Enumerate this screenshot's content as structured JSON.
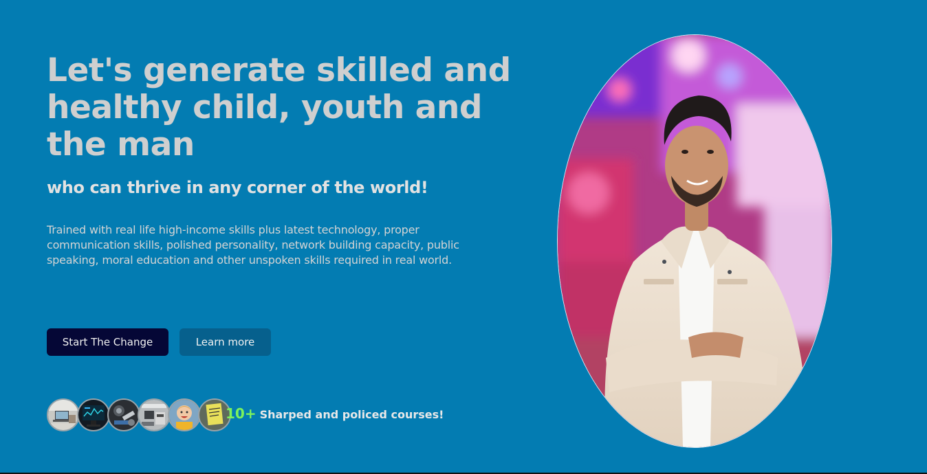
{
  "hero": {
    "headline": "Let's generate skilled and healthy child, youth and the man",
    "subheadline": "who can thrive in any corner of the world!",
    "description": "Trained with real life high-income skills plus latest technology, proper communication skills, polished personality, network building capacity, public speaking, moral education and other unspoken skills required in real world.",
    "primary_button": "Start The Change",
    "secondary_button": "Learn more",
    "courses": {
      "count": "10+",
      "label": "Sharped and policed courses!"
    },
    "avatars": [
      "laptop-classroom-photo",
      "monitor-screen-photo",
      "robotics-kit-photo",
      "electronics-workbench-photo",
      "smiling-child-photo",
      "handwritten-note-photo"
    ],
    "portrait": "student-portrait-photo"
  },
  "colors": {
    "background": "#037cb2",
    "primary_button": "#050736",
    "secondary_button": "#06608d",
    "count_accent": "#7cf25c",
    "headline": "#cfcfcf"
  }
}
